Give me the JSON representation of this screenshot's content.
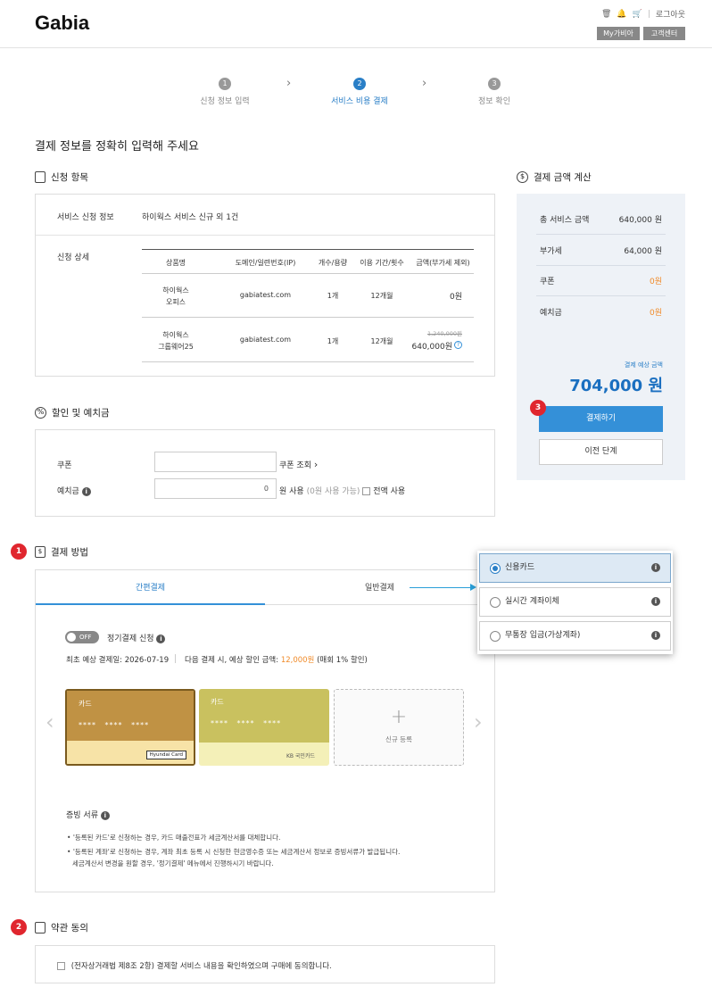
{
  "header": {
    "logo": "Gabia",
    "login": "로그아웃",
    "my_gabia": "My가비아",
    "customer_center": "고객센터"
  },
  "steps": [
    {
      "num": "1",
      "label": "신청 정보 입력"
    },
    {
      "num": "2",
      "label": "서비스 비용 결제"
    },
    {
      "num": "3",
      "label": "정보 확인"
    }
  ],
  "page_title": "결제 정보를 정확히 입력해 주세요",
  "application": {
    "title": "신청 항목",
    "service_info_label": "서비스 신청 정보",
    "service_info_value": "하이웍스 서비스 신규 외 1건",
    "detail_label": "신청 상세",
    "columns": [
      "상품명",
      "도메인/일련번호(IP)",
      "개수/용량",
      "이용 기간/횟수",
      "금액(부가세 제외)"
    ],
    "rows": [
      {
        "product_line1": "하이웍스",
        "product_line2": "오피스",
        "domain": "gabiatest.com",
        "qty": "1개",
        "period": "12개월",
        "amount": "0원",
        "original": ""
      },
      {
        "product_line1": "하이웍스",
        "product_line2": "그룹웨어25",
        "domain": "gabiatest.com",
        "qty": "1개",
        "period": "12개월",
        "amount": "640,000원",
        "original": "1,240,000원"
      }
    ]
  },
  "discount": {
    "title": "할인 및 예치금",
    "coupon_label": "쿠폰",
    "coupon_link": "쿠폰 조회",
    "deposit_label": "예치금",
    "deposit_value": "0",
    "deposit_unit": "원 사용",
    "deposit_available": "(0원 사용 가능)",
    "use_all": "전액 사용"
  },
  "payment_method": {
    "title": "결제 방법",
    "tabs": [
      "간편결제",
      "일반결제"
    ],
    "toggle_label": "OFF",
    "regular_label": "정기결제 신청",
    "first_date": "최초 예상 결제일: 2026-07-19",
    "next_text_prefix": "다음 결제 시, 예상 할인 금액: ",
    "next_amount": "12,000원",
    "next_text_suffix": " (매회 1% 할인)",
    "cards": [
      {
        "title": "카드",
        "number": "**** **** ****",
        "brand": "Hyundai Card"
      },
      {
        "title": "카드",
        "number": "**** **** ****",
        "brand": "KB 국민카드"
      }
    ],
    "add_card": "신규 등록",
    "receipt_title": "증빙 서류",
    "notes": [
      "'등록된 카드'로 신청하는 경우, 카드 매출전표가 세금계산서를 대체합니다.",
      "'등록된 계좌'로 신청하는 경우, 계좌 최초 등록 시 신청한 현금영수증 또는 세금계산서 정보로 증빙서류가 발급됩니다.",
      "세금계산서 변경을 원할 경우, '정기결제' 메뉴에서 진행하시기 바랍니다."
    ]
  },
  "pay_options": [
    "신용카드",
    "실시간 계좌이체",
    "무통장 입금(가상계좌)"
  ],
  "terms": {
    "title": "약관 동의",
    "agree_text": "(전자상거래법 제8조 2항) 결제할 서비스 내용을 확인하였으며 구매에 동의합니다."
  },
  "summary": {
    "title": "결제 금액 계산",
    "rows": [
      {
        "label": "총 서비스 금액",
        "value": "640,000 원"
      },
      {
        "label": "부가세",
        "value": "64,000 원"
      },
      {
        "label": "쿠폰",
        "value": "0원"
      },
      {
        "label": "예치금",
        "value": "0원"
      }
    ],
    "expected_label": "결제 예상 금액",
    "expected_amount": "704,000 원",
    "pay_button": "결제하기",
    "prev_button": "이전 단계"
  },
  "badges": [
    "1",
    "2",
    "3"
  ],
  "colors": {
    "accent": "#3490d8",
    "badge": "#e0262e",
    "orange": "#f08b2a"
  }
}
